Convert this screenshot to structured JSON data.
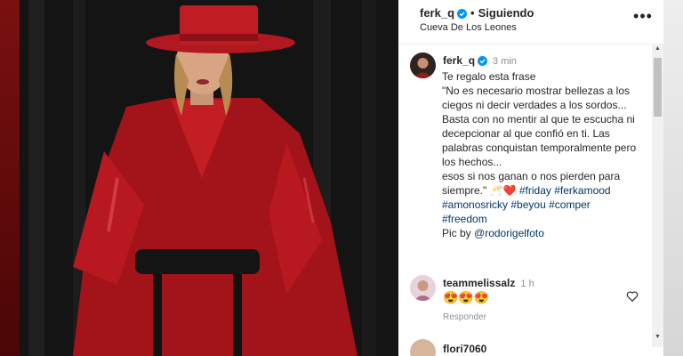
{
  "post": {
    "username": "ferk_q",
    "follow_state": "Siguiendo",
    "location": "Cueva De Los Leones",
    "more_icon": "more-horizontal-icon"
  },
  "caption": {
    "username": "ferk_q",
    "time": "3 min",
    "intro": "Te regalo esta frase",
    "quote": "\"No es necesario mostrar bellezas a los ciegos ni decir verdades a los sordos... Basta con no mentir al que te escucha ni decepcionar al que confió en ti. Las palabras conquistan temporalmente pero los hechos...",
    "closing": "esos si nos ganan o nos pierden para siempre.\"",
    "emojis": "🥂❤️",
    "hashtags_line1": [
      "#friday",
      "#ferkamood"
    ],
    "hashtags_line2": [
      "#amonosricky",
      "#beyou",
      "#comper"
    ],
    "hashtags_line3": [
      "#freedom"
    ],
    "credit_prefix": "Pic by",
    "credit_mention": "@rodorigelfoto"
  },
  "comments": [
    {
      "username": "teammelissalz",
      "time": "1 h",
      "text": "😍😍😍",
      "reply_label": "Responder"
    },
    {
      "username": "flori7060"
    }
  ],
  "colors": {
    "accent_link": "#00376b",
    "verified": "#0095f6",
    "text": "#262626",
    "muted": "#8e8e8e"
  }
}
